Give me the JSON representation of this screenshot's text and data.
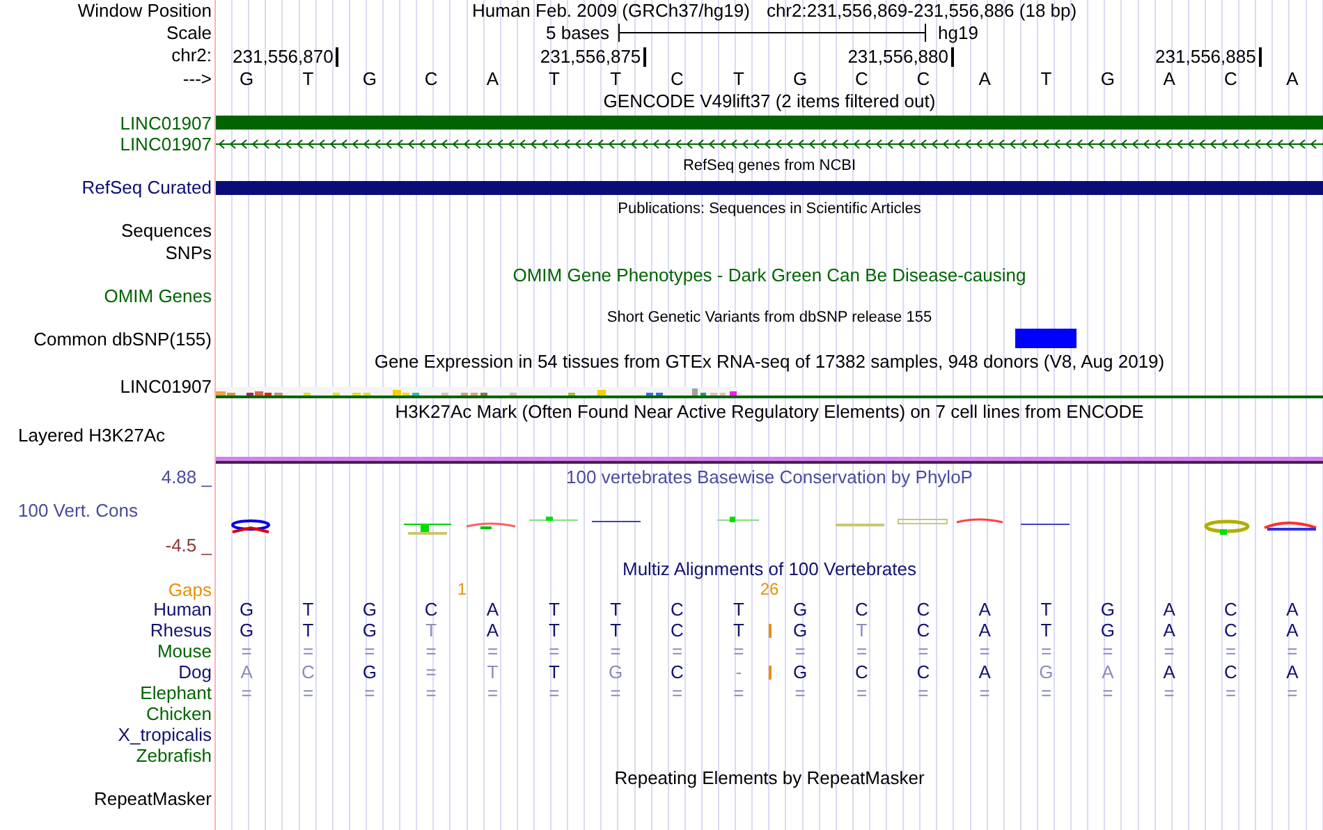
{
  "header": {
    "label": "Window Position",
    "assembly_title": "Human Feb. 2009 (GRCh37/hg19)",
    "position": "chr2:231,556,869-231,556,886 (18 bp)"
  },
  "scale": {
    "label": "Scale",
    "text": "5 bases",
    "assembly": "hg19"
  },
  "ruler": {
    "label": "chr2:",
    "ticks": [
      "231,556,870",
      "231,556,875",
      "231,556,880",
      "231,556,885"
    ]
  },
  "sequence": {
    "label": "--->",
    "bases": [
      {
        "base": "G"
      },
      {
        "base": "T"
      },
      {
        "base": "G"
      },
      {
        "base": "C"
      },
      {
        "base": "A"
      },
      {
        "base": "T"
      },
      {
        "base": "T"
      },
      {
        "base": "C"
      },
      {
        "base": "T"
      },
      {
        "base": "G"
      },
      {
        "base": "C"
      },
      {
        "base": "C"
      },
      {
        "base": "A"
      },
      {
        "base": "T",
        "common_snp": true
      },
      {
        "base": "G"
      },
      {
        "base": "A"
      },
      {
        "base": "C"
      },
      {
        "base": "A"
      }
    ]
  },
  "tracks": [
    {
      "kind": "gene",
      "title": "GENCODE V49lift37 (2 items filtered out)",
      "small_title": false,
      "color": "#000000",
      "items": [
        {
          "label": "LINC01907",
          "color": "#006400",
          "kind": "bar"
        },
        {
          "label": "LINC01907",
          "color": "#006400",
          "kind": "arrows"
        }
      ]
    },
    {
      "kind": "gene",
      "title": "RefSeq genes from NCBI",
      "small_title": true,
      "color": "#000000",
      "items": [
        {
          "label": "RefSeq Curated",
          "color": "#0c0c78",
          "kind": "bar"
        }
      ]
    },
    {
      "kind": "gene",
      "title": "Publications: Sequences in Scientific Articles",
      "small_title": true,
      "color": "#000000",
      "items": [
        {
          "label": "Sequences",
          "color": "#000000",
          "kind": "empty"
        },
        {
          "label": "SNPs",
          "color": "#000000",
          "kind": "empty"
        }
      ]
    },
    {
      "kind": "gene",
      "title": "OMIM Gene Phenotypes - Dark Green Can Be Disease-causing",
      "small_title": false,
      "color": "#006400",
      "items": [
        {
          "label": "OMIM Genes",
          "color": "#006400",
          "kind": "empty"
        }
      ]
    },
    {
      "kind": "snp",
      "title": "Short Genetic Variants from dbSNP release 155",
      "small_title": true,
      "color": "#000000",
      "label": "Common dbSNP(155)"
    },
    {
      "kind": "expression",
      "title": "Gene Expression in 54 tissues from GTEx RNA-seq of 17382 samples, 948 donors (V8, Aug 2019)",
      "small_title": false,
      "color": "#000000",
      "label": "LINC01907"
    },
    {
      "kind": "band",
      "title": "H3K27Ac Mark (Often Found Near Active Regulatory Elements) on 7 cell lines from ENCODE",
      "small_title": false,
      "color": "#000000",
      "label": "Layered H3K27Ac"
    },
    {
      "kind": "conservation",
      "title": "100 vertebrates Basewise Conservation by PhyloP",
      "small_title": false,
      "color": "#4a4a9e",
      "max": "4.88 _",
      "label": "100 Vert. Cons",
      "min": "-4.5 _"
    },
    {
      "kind": "alignment",
      "title": "Multiz Alignments of 100 Vertebrates",
      "small_title": false,
      "color": "#12126e",
      "gaps_label": "Gaps",
      "species": [
        {
          "name": "Human",
          "color": "#12126e",
          "bases": [
            {
              "text": "G",
              "kind": "strong"
            },
            {
              "text": "T",
              "kind": "strong"
            },
            {
              "text": "G",
              "kind": "strong"
            },
            {
              "text": "C",
              "kind": "strong"
            },
            {
              "text": "A",
              "kind": "strong",
              "gap_count": "1"
            },
            {
              "text": "T",
              "kind": "strong"
            },
            {
              "text": "T",
              "kind": "strong"
            },
            {
              "text": "C",
              "kind": "strong"
            },
            {
              "text": "T",
              "kind": "strong"
            },
            {
              "text": "G",
              "kind": "strong",
              "gap_count": "26"
            },
            {
              "text": "C",
              "kind": "strong"
            },
            {
              "text": "C",
              "kind": "strong"
            },
            {
              "text": "A",
              "kind": "strong"
            },
            {
              "text": "T",
              "kind": "strong"
            },
            {
              "text": "G",
              "kind": "strong"
            },
            {
              "text": "A",
              "kind": "strong"
            },
            {
              "text": "C",
              "kind": "strong"
            },
            {
              "text": "A",
              "kind": "strong"
            }
          ]
        },
        {
          "name": "Rhesus",
          "color": "#12126e",
          "bases": [
            {
              "text": "G",
              "kind": "strong"
            },
            {
              "text": "T",
              "kind": "strong"
            },
            {
              "text": "G",
              "kind": "strong"
            },
            {
              "text": "T",
              "kind": "faint"
            },
            {
              "text": "A",
              "kind": "strong"
            },
            {
              "text": "T",
              "kind": "strong"
            },
            {
              "text": "T",
              "kind": "strong"
            },
            {
              "text": "C",
              "kind": "strong"
            },
            {
              "text": "T",
              "kind": "strong"
            },
            {
              "text": "G",
              "kind": "strong",
              "insertion_before": true
            },
            {
              "text": "T",
              "kind": "faint"
            },
            {
              "text": "C",
              "kind": "strong"
            },
            {
              "text": "A",
              "kind": "strong"
            },
            {
              "text": "T",
              "kind": "strong"
            },
            {
              "text": "G",
              "kind": "strong"
            },
            {
              "text": "A",
              "kind": "strong"
            },
            {
              "text": "C",
              "kind": "strong"
            },
            {
              "text": "A",
              "kind": "strong"
            }
          ]
        },
        {
          "name": "Mouse",
          "color": "#006400",
          "bases": [
            {
              "text": "=",
              "kind": "faint"
            },
            {
              "text": "=",
              "kind": "faint"
            },
            {
              "text": "=",
              "kind": "faint"
            },
            {
              "text": "=",
              "kind": "faint"
            },
            {
              "text": "=",
              "kind": "faint"
            },
            {
              "text": "=",
              "kind": "faint"
            },
            {
              "text": "=",
              "kind": "faint"
            },
            {
              "text": "=",
              "kind": "faint"
            },
            {
              "text": "=",
              "kind": "faint"
            },
            {
              "text": "=",
              "kind": "faint"
            },
            {
              "text": "=",
              "kind": "faint"
            },
            {
              "text": "=",
              "kind": "faint"
            },
            {
              "text": "=",
              "kind": "faint"
            },
            {
              "text": "=",
              "kind": "faint"
            },
            {
              "text": "=",
              "kind": "faint"
            },
            {
              "text": "=",
              "kind": "faint"
            },
            {
              "text": "=",
              "kind": "faint"
            },
            {
              "text": "=",
              "kind": "faint"
            }
          ]
        },
        {
          "name": "Dog",
          "color": "#12126e",
          "bases": [
            {
              "text": "A",
              "kind": "faint"
            },
            {
              "text": "C",
              "kind": "faint"
            },
            {
              "text": "G",
              "kind": "strong"
            },
            {
              "text": "=",
              "kind": "faint"
            },
            {
              "text": "T",
              "kind": "faint"
            },
            {
              "text": "T",
              "kind": "strong"
            },
            {
              "text": "G",
              "kind": "faint"
            },
            {
              "text": "C",
              "kind": "strong"
            },
            {
              "text": "-",
              "kind": "faint"
            },
            {
              "text": "G",
              "kind": "strong",
              "insertion_before": true
            },
            {
              "text": "C",
              "kind": "strong"
            },
            {
              "text": "C",
              "kind": "strong"
            },
            {
              "text": "A",
              "kind": "strong"
            },
            {
              "text": "G",
              "kind": "faint"
            },
            {
              "text": "A",
              "kind": "faint"
            },
            {
              "text": "A",
              "kind": "strong"
            },
            {
              "text": "C",
              "kind": "strong"
            },
            {
              "text": "A",
              "kind": "strong"
            }
          ]
        },
        {
          "name": "Elephant",
          "color": "#006400",
          "bases": [
            {
              "text": "=",
              "kind": "faint"
            },
            {
              "text": "=",
              "kind": "faint"
            },
            {
              "text": "=",
              "kind": "faint"
            },
            {
              "text": "=",
              "kind": "faint"
            },
            {
              "text": "=",
              "kind": "faint"
            },
            {
              "text": "=",
              "kind": "faint"
            },
            {
              "text": "=",
              "kind": "faint"
            },
            {
              "text": "=",
              "kind": "faint"
            },
            {
              "text": "=",
              "kind": "faint"
            },
            {
              "text": "=",
              "kind": "faint"
            },
            {
              "text": "=",
              "kind": "faint"
            },
            {
              "text": "=",
              "kind": "faint"
            },
            {
              "text": "=",
              "kind": "faint"
            },
            {
              "text": "=",
              "kind": "faint"
            },
            {
              "text": "=",
              "kind": "faint"
            },
            {
              "text": "=",
              "kind": "faint"
            },
            {
              "text": "=",
              "kind": "faint"
            },
            {
              "text": "=",
              "kind": "faint"
            }
          ]
        },
        {
          "name": "Chicken",
          "color": "#006400"
        },
        {
          "name": "X_tropicalis",
          "color": "#12126e"
        },
        {
          "name": "Zebrafish",
          "color": "#006400"
        }
      ]
    },
    {
      "kind": "repeats",
      "title": "Repeating Elements by RepeatMasker",
      "small_title": false,
      "color": "#000000",
      "label": "RepeatMasker"
    }
  ]
}
